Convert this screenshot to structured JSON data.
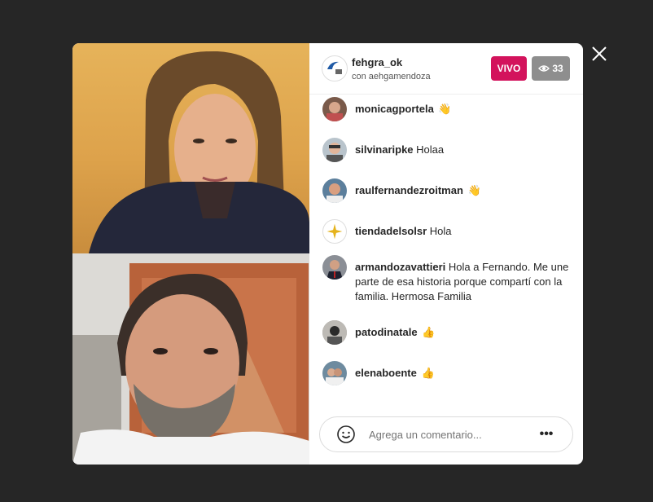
{
  "header": {
    "username": "fehgra_ok",
    "with_text": "con aehgamendoza",
    "live_label": "VIVO",
    "viewer_count": "33"
  },
  "comments": [
    {
      "user": "monicagportela",
      "text": "",
      "emoji": "👋"
    },
    {
      "user": "silvinaripke",
      "text": "Holaa",
      "emoji": ""
    },
    {
      "user": "raulfernandezroitman",
      "text": "",
      "emoji": "👋"
    },
    {
      "user": "tiendadelsolsr",
      "text": "Hola",
      "emoji": ""
    },
    {
      "user": "armandozavattieri",
      "text": "Hola a Fernando. Me une parte de esa historia porque compartí con la familia. Hermosa Familia",
      "emoji": ""
    },
    {
      "user": "patodinatale",
      "text": "",
      "emoji": "👍"
    },
    {
      "user": "elenaboente",
      "text": "",
      "emoji": "👍"
    }
  ],
  "composer": {
    "placeholder": "Agrega un comentario...",
    "more_label": "•••"
  },
  "colors": {
    "live_badge": "#d3135c",
    "viewers_badge": "#8e8e8e",
    "backdrop": "#262626"
  },
  "icons": [
    "close-icon",
    "eye-icon",
    "smile-icon",
    "more-icon"
  ]
}
